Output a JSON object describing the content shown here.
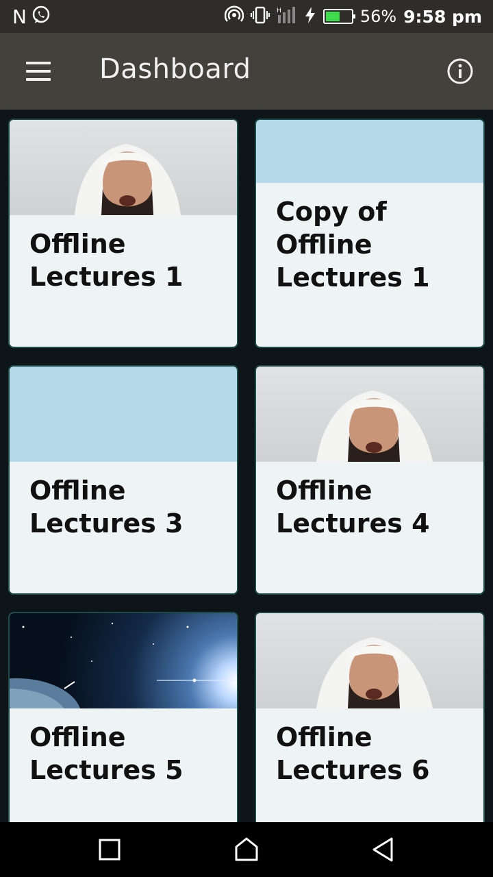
{
  "status_bar": {
    "carrier_icon": "N",
    "notification_icons": [
      "whatsapp-icon"
    ],
    "system_icons": [
      "hotspot-icon",
      "vibrate-icon",
      "signal-icon",
      "charging-icon",
      "battery-icon"
    ],
    "battery_percent": "56%",
    "battery_level": 0.56,
    "time": "9:58 pm"
  },
  "app_bar": {
    "title": "Dashboard",
    "menu_icon": "hamburger-menu-icon",
    "info_icon": "info-icon"
  },
  "cards": [
    {
      "label": "Offline\nLectures 1",
      "image": "lecturer-photo"
    },
    {
      "label": "Copy of\nOffline\nLectures 1",
      "image": "blue-placeholder"
    },
    {
      "label": "Offline\nLectures 3",
      "image": "blue-placeholder"
    },
    {
      "label": "Offline\nLectures 4",
      "image": "lecturer-photo"
    },
    {
      "label": "Offline\nLectures 5",
      "image": "space-planet"
    },
    {
      "label": "Offline\nLectures 6",
      "image": "lecturer-photo"
    }
  ],
  "nav_bar": {
    "buttons": [
      "recents-button",
      "home-button",
      "back-button"
    ]
  },
  "colors": {
    "status_bar": "#2e2d29",
    "app_bar": "#42413c",
    "background": "#0e1519",
    "card": "#eef4f3",
    "card_border": "#1d4c48",
    "placeholder": "#b5d9e8",
    "battery_fill": "#3ddc4a"
  }
}
